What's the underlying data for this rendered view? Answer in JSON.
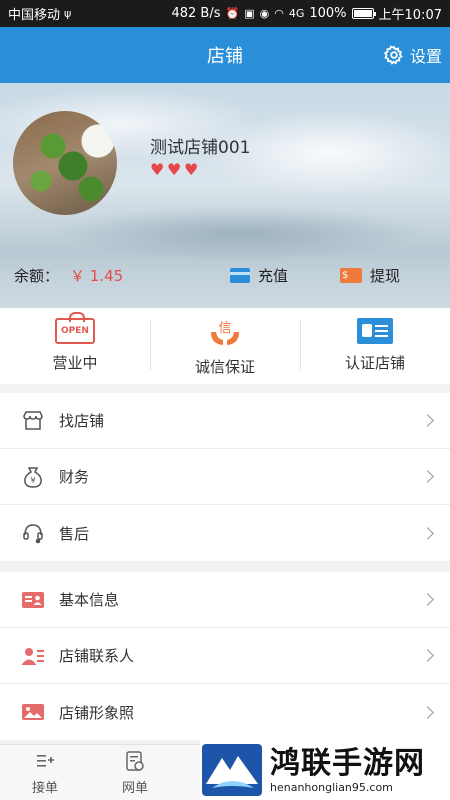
{
  "status_bar": {
    "carrier": "中国移动",
    "usb": "ψ",
    "speed": "482 B/s",
    "signal_label": "4G",
    "battery": "100%",
    "battery_level": 1.0,
    "time": "上午10:07"
  },
  "nav": {
    "title": "店铺",
    "settings_label": "设置"
  },
  "profile": {
    "shop_name": "测试店铺001",
    "hearts": [
      "♥",
      "♥",
      "♥"
    ],
    "balance_label": "余额：",
    "balance_value": "￥ 1.45",
    "recharge_label": "充值",
    "withdraw_label": "提现"
  },
  "badges": [
    {
      "icon": "open-sign",
      "icon_text": "OPEN",
      "label": "营业中"
    },
    {
      "icon": "trust-hands",
      "icon_text": "信",
      "label": "诚信保证"
    },
    {
      "icon": "id-card",
      "icon_text": "",
      "label": "认证店铺"
    }
  ],
  "menu_group_1": [
    {
      "icon": "store-icon",
      "label": "找店铺"
    },
    {
      "icon": "money-bag-icon",
      "label": "财务"
    },
    {
      "icon": "headset-icon",
      "label": "售后"
    }
  ],
  "menu_group_2": [
    {
      "icon": "info-card-icon",
      "label": "基本信息"
    },
    {
      "icon": "contact-icon",
      "label": "店铺联系人"
    },
    {
      "icon": "image-icon",
      "label": "店铺形象照"
    }
  ],
  "tabbar": [
    {
      "icon": "orders-icon",
      "label": "接单"
    },
    {
      "icon": "web-order-icon",
      "label": "网单"
    }
  ],
  "watermark": {
    "title": "鸿联手游网",
    "url": "henanhonglian95.com"
  },
  "colors": {
    "primary": "#2a8fd8",
    "price": "#e54b4b",
    "accent_orange": "#ef7a3b",
    "icon_red": "#e05a50"
  }
}
